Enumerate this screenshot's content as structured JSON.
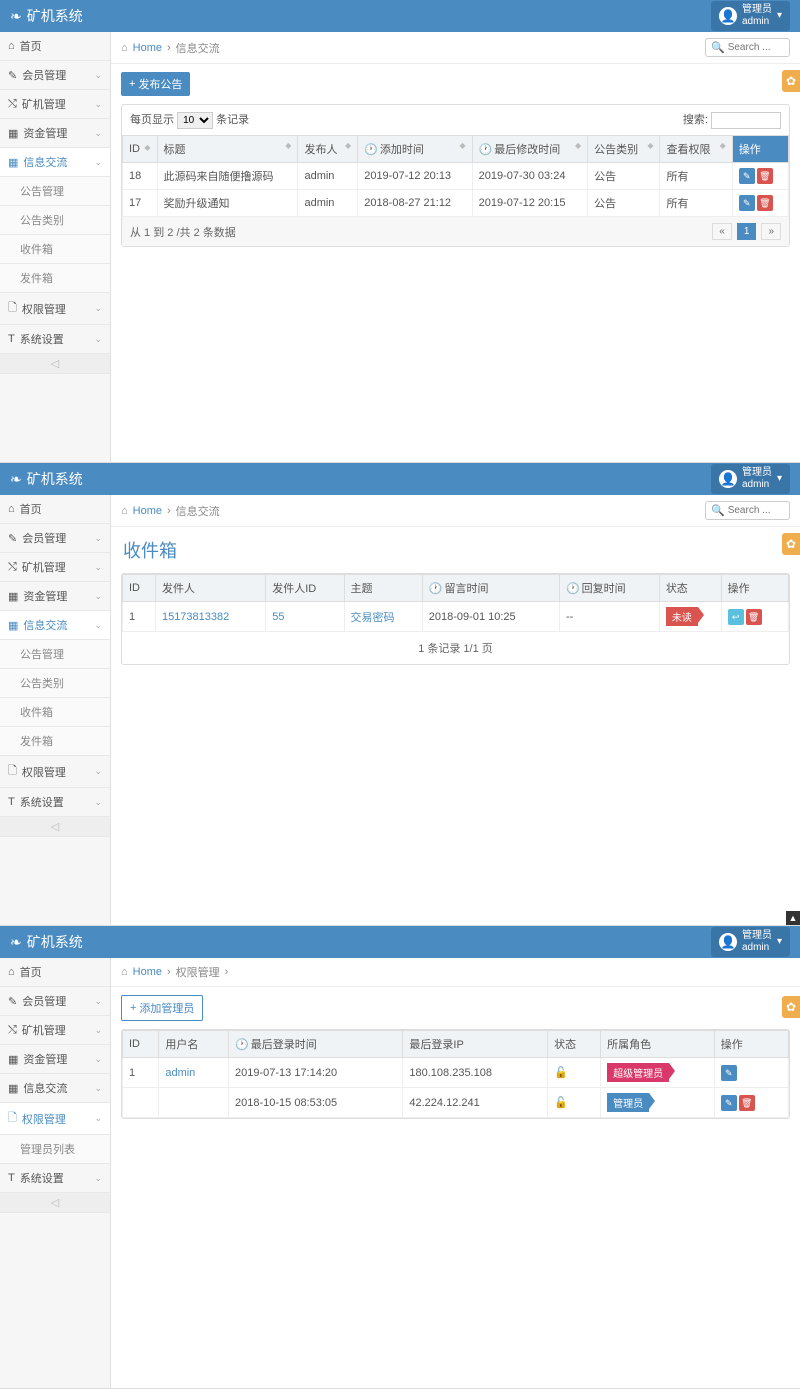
{
  "brand": "矿机系统",
  "user": {
    "role": "管理员",
    "name": "admin"
  },
  "search_placeholder": "Search ...",
  "home_label": "Home",
  "sidebar": {
    "items": [
      {
        "icon": "⌂",
        "label": "首页"
      },
      {
        "icon": "✎",
        "label": "会员管理"
      },
      {
        "icon": "⤭",
        "label": "矿机管理"
      },
      {
        "icon": "▦",
        "label": "资金管理"
      },
      {
        "icon": "▦",
        "label": "信息交流"
      },
      {
        "icon": "🗋",
        "label": "权限管理"
      },
      {
        "icon": "T",
        "label": "系统设置"
      }
    ],
    "info_sub": [
      "公告管理",
      "公告类别",
      "收件箱",
      "发件箱"
    ],
    "perm_sub": [
      "管理员列表"
    ]
  },
  "panel1": {
    "crumb": "信息交流",
    "button": "发布公告",
    "perpage_prefix": "每页显示",
    "perpage_value": "10",
    "perpage_suffix": "条记录",
    "search_label": "搜索:",
    "headers": [
      "ID",
      "标题",
      "发布人",
      "添加时间",
      "最后修改时间",
      "公告类别",
      "查看权限",
      "操作"
    ],
    "rows": [
      {
        "id": "18",
        "title": "此源码来自随便撸源码",
        "author": "admin",
        "add": "2019-07-12 20:13",
        "mod": "2019-07-30 03:24",
        "cat": "公告",
        "perm": "所有"
      },
      {
        "id": "17",
        "title": "奖励升级通知",
        "author": "admin",
        "add": "2018-08-27 21:12",
        "mod": "2019-07-12 20:15",
        "cat": "公告",
        "perm": "所有"
      }
    ],
    "info": "从 1 到 2 /共 2 条数据",
    "page": "1"
  },
  "panel2": {
    "crumb": "信息交流",
    "title": "收件箱",
    "headers": [
      "ID",
      "发件人",
      "发件人ID",
      "主题",
      "留言时间",
      "回复时间",
      "状态",
      "操作"
    ],
    "row": {
      "id": "1",
      "sender": "15173813382",
      "sender_id": "55",
      "subject": "交易密码",
      "msg_time": "2018-09-01 10:25",
      "reply_time": "--",
      "status": "未读"
    },
    "info": "1 条记录 1/1 页"
  },
  "panel3": {
    "crumb": "权限管理",
    "button": "添加管理员",
    "headers": [
      "ID",
      "用户名",
      "最后登录时间",
      "最后登录IP",
      "状态",
      "所属角色",
      "操作"
    ],
    "rows": [
      {
        "id": "1",
        "user": "admin",
        "time": "2019-07-13 17:14:20",
        "ip": "180.108.235.108",
        "role": "超级管理员",
        "role_class": "pink"
      },
      {
        "id": "",
        "user": "",
        "time": "2018-10-15 08:53:05",
        "ip": "42.224.12.241",
        "role": "管理员",
        "role_class": "blue"
      }
    ]
  }
}
